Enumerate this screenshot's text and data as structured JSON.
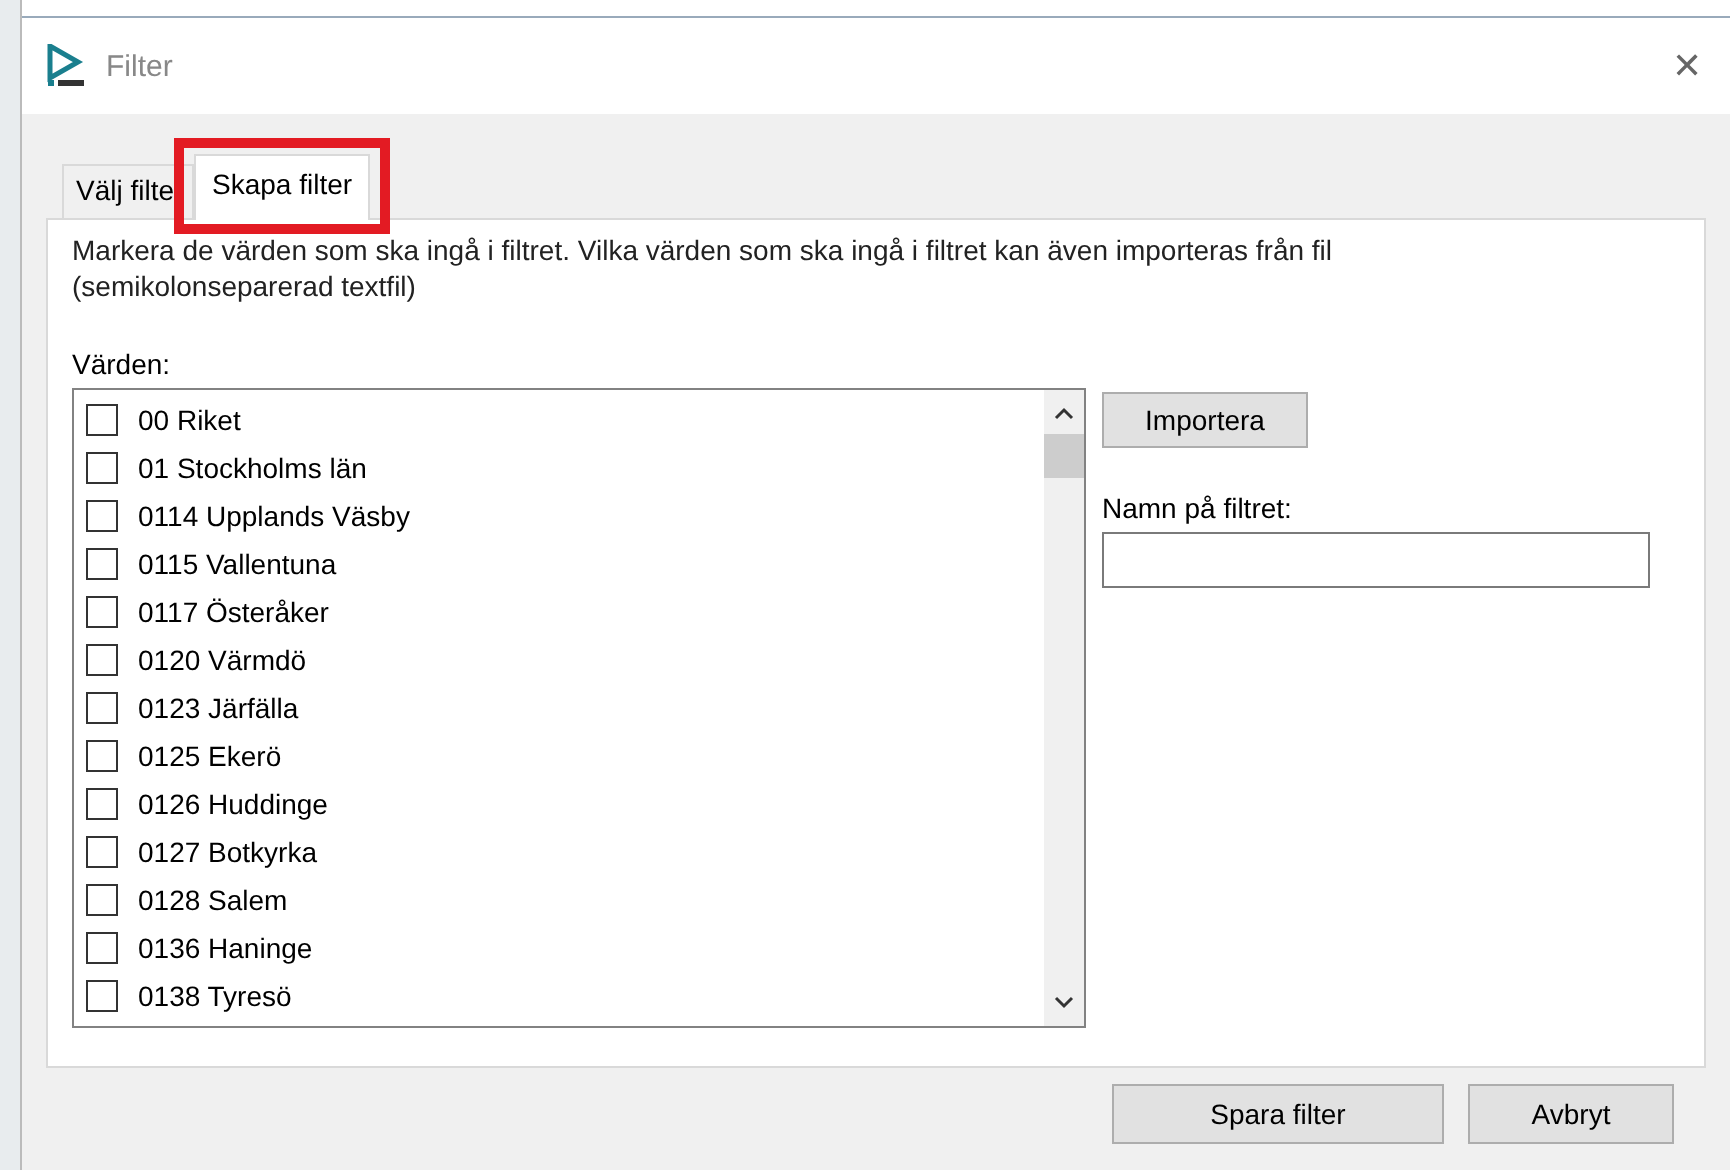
{
  "window": {
    "title": "Filter",
    "close": "✕"
  },
  "tabs": [
    {
      "label": "Välj filte",
      "selected": false,
      "highlighted": false
    },
    {
      "label": "Skapa filter",
      "selected": true,
      "highlighted": true
    }
  ],
  "instructions": "Markera de värden som ska ingå i filtret. Vilka värden som ska ingå i filtret kan även importeras från fil (semikolonseparerad textfil)",
  "values_label": "Värden:",
  "values": [
    {
      "label": "00 Riket",
      "checked": false
    },
    {
      "label": "01 Stockholms län",
      "checked": false
    },
    {
      "label": "0114 Upplands Väsby",
      "checked": false
    },
    {
      "label": "0115 Vallentuna",
      "checked": false
    },
    {
      "label": "0117 Österåker",
      "checked": false
    },
    {
      "label": "0120 Värmdö",
      "checked": false
    },
    {
      "label": "0123 Järfälla",
      "checked": false
    },
    {
      "label": "0125 Ekerö",
      "checked": false
    },
    {
      "label": "0126 Huddinge",
      "checked": false
    },
    {
      "label": "0127 Botkyrka",
      "checked": false
    },
    {
      "label": "0128 Salem",
      "checked": false
    },
    {
      "label": "0136 Haninge",
      "checked": false
    },
    {
      "label": "0138 Tyresö",
      "checked": false
    }
  ],
  "import_button": "Importera",
  "name_label": "Namn på filtret:",
  "buttons": [
    "Spara filter",
    "Avbryt"
  ]
}
